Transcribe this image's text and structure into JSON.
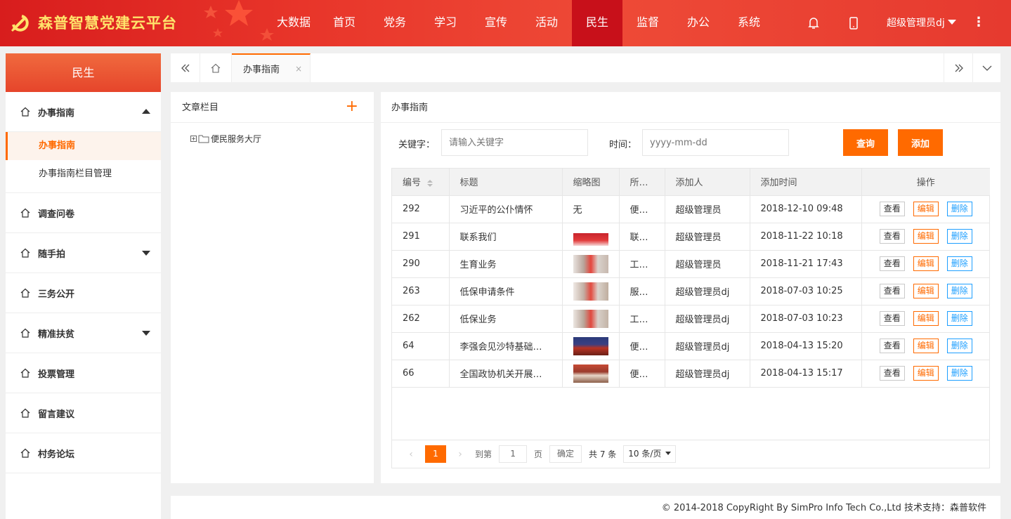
{
  "header": {
    "logo_text": "森普智慧党建云平台",
    "nav": [
      "大数据",
      "首页",
      "党务",
      "学习",
      "宣传",
      "活动",
      "民生",
      "监督",
      "办公",
      "系统"
    ],
    "active_nav": "民生",
    "user_name": "超级管理员dj",
    "more": "⋮",
    "colors": {
      "bar": "#e8352a",
      "active": "#c8101a",
      "logo_text": "#ffe36b"
    }
  },
  "sidebar": {
    "title": "民生",
    "groups": [
      {
        "label": "办事指南",
        "expanded": true,
        "subitems": [
          "办事指南",
          "办事指南栏目管理"
        ],
        "active_sub": "办事指南"
      },
      {
        "label": "调查问卷"
      },
      {
        "label": "随手拍",
        "has_children": true
      },
      {
        "label": "三务公开"
      },
      {
        "label": "精准扶贫",
        "has_children": true
      },
      {
        "label": "投票管理"
      },
      {
        "label": "留言建议"
      },
      {
        "label": "村务论坛"
      }
    ]
  },
  "tabs": {
    "active_tab": "办事指南",
    "close": "×"
  },
  "category_panel": {
    "title": "文章栏目",
    "add": "+",
    "tree": [
      {
        "label": "便民服务大厅",
        "expander": "+"
      }
    ]
  },
  "main_panel": {
    "title": "办事指南",
    "search": {
      "keyword_label": "关键字：",
      "keyword_placeholder": "请输入关键字",
      "time_label": "时间：",
      "time_placeholder": "yyyy-mm-dd",
      "query_button": "查询",
      "add_button": "添加"
    },
    "table": {
      "columns": [
        "编号",
        "标题",
        "缩略图",
        "所…",
        "添加人",
        "添加时间",
        "操作"
      ],
      "actions": {
        "view": "查看",
        "edit": "编辑",
        "delete": "删除"
      },
      "rows": [
        {
          "id": "292",
          "title": "习近平的公仆情怀",
          "thumb": "无",
          "category": "便…",
          "author": "超级管理员",
          "time": "2018-12-10 09:48"
        },
        {
          "id": "291",
          "title": "联系我们",
          "thumb": "image",
          "category": "联…",
          "author": "超级管理员",
          "time": "2018-11-22 10:18"
        },
        {
          "id": "290",
          "title": "生育业务",
          "thumb": "image",
          "category": "工…",
          "author": "超级管理员",
          "time": "2018-11-21 17:43"
        },
        {
          "id": "263",
          "title": "低保申请条件",
          "thumb": "image",
          "category": "服…",
          "author": "超级管理员dj",
          "time": "2018-07-03 10:25"
        },
        {
          "id": "262",
          "title": "低保业务",
          "thumb": "image",
          "category": "工…",
          "author": "超级管理员dj",
          "time": "2018-07-03 10:23"
        },
        {
          "id": "64",
          "title": "李强会见沙特基础…",
          "thumb": "image",
          "category": "便…",
          "author": "超级管理员dj",
          "time": "2018-04-13 15:20"
        },
        {
          "id": "66",
          "title": "全国政协机关开展…",
          "thumb": "image",
          "category": "便…",
          "author": "超级管理员dj",
          "time": "2018-04-13 15:17"
        }
      ]
    },
    "pager": {
      "prev": "‹",
      "next": "›",
      "current_page": "1",
      "goto_label": "到第",
      "goto_value": "1",
      "page_unit": "页",
      "confirm": "确定",
      "total": "共 7 条",
      "page_size": "10 条/页"
    }
  },
  "footer": {
    "text": "© 2014-2018 CopyRight By SimPro Info Tech Co.,Ltd 技术支持：森普软件"
  }
}
